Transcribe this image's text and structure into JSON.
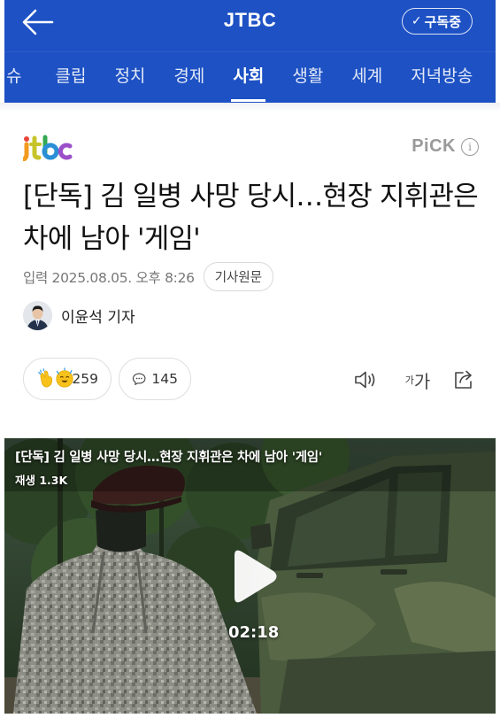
{
  "header": {
    "brand": "JTBC",
    "subscribe_label": "구독중",
    "nav": [
      {
        "label": "슈",
        "active": false
      },
      {
        "label": "클립",
        "active": false
      },
      {
        "label": "정치",
        "active": false
      },
      {
        "label": "경제",
        "active": false
      },
      {
        "label": "사회",
        "active": true
      },
      {
        "label": "생활",
        "active": false
      },
      {
        "label": "세계",
        "active": false
      },
      {
        "label": "저녁방송",
        "active": false
      }
    ]
  },
  "article": {
    "press_logo": "jtbc",
    "pick_label": "PiCK",
    "title": "[단독] 김 일병 사망 당시…현장 지휘관은 차에 남아 '게임'",
    "date": "입력 2025.08.05. 오후 8:26",
    "original_button": "기사원문",
    "reporter": "이윤석 기자",
    "reaction_count": "259",
    "comment_count": "145",
    "font_size_label_small": "가",
    "font_size_label_large": "가"
  },
  "video": {
    "title": "[단독] 김 일병 사망 당시…현장 지휘관은 차에 남아 '게임'",
    "views": "재생 1.3K",
    "duration": "02:18"
  },
  "colors": {
    "header_bg": "#1d51c4",
    "text_primary": "#111111",
    "text_muted": "#777777",
    "emoji_yellow": "#f7c21b"
  },
  "icons": [
    "back-arrow-icon",
    "check-icon",
    "info-icon",
    "clap-emoji-icon",
    "celebrate-emoji-icon",
    "comment-icon",
    "speaker-icon",
    "share-icon",
    "play-icon"
  ]
}
